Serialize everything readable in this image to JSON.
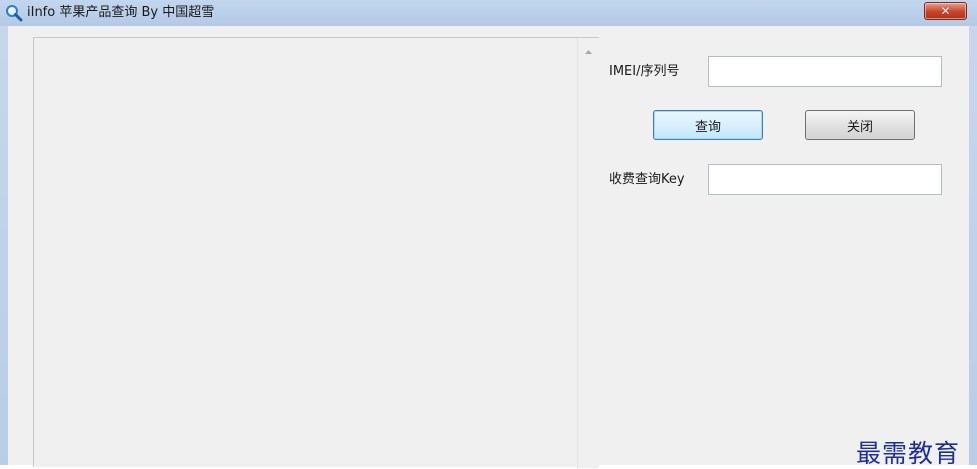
{
  "window": {
    "title": "iInfo 苹果产品查询 By 中国超雪",
    "close_glyph": "✕"
  },
  "form": {
    "imei_label": "IMEI/序列号",
    "imei_value": "",
    "query_button": "查询",
    "close_button": "关闭",
    "key_label": "收费查询Key",
    "key_value": ""
  },
  "output": {
    "text": "",
    "scroll_up_icon": "chevron-up-icon"
  },
  "watermark": {
    "text": "最需教育"
  }
}
